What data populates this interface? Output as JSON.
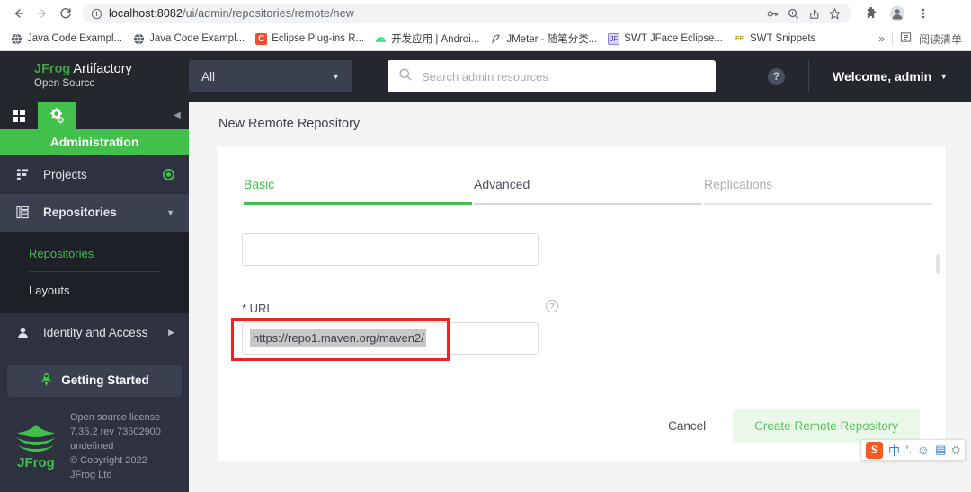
{
  "browser": {
    "nav": {
      "back_icon": "arrow-left-icon",
      "forward_icon": "arrow-right-icon",
      "reload_icon": "reload-icon"
    },
    "omnibox": {
      "site_info_icon": "info-circle-icon",
      "host": "localhost:8082",
      "path": "/ui/admin/repositories/remote/new",
      "actions": [
        "key-icon",
        "zoom-icon",
        "share-icon",
        "star-icon"
      ]
    },
    "toolbar_right": [
      "extensions-puzzle-icon",
      "profile-avatar-icon",
      "kebab-menu-icon"
    ],
    "bookmarks": [
      {
        "label": "Java Code Exampl...",
        "icon": "globe-icon"
      },
      {
        "label": "Java Code Exampl...",
        "icon": "globe-icon"
      },
      {
        "label": "Eclipse Plug-ins R...",
        "icon": "letter-c-icon"
      },
      {
        "label": "开发应用 | Androi...",
        "icon": "android-icon"
      },
      {
        "label": "JMeter - 随笔分类...",
        "icon": "feather-icon"
      },
      {
        "label": "SWT JFace Eclipse...",
        "icon": "blue-square-icon"
      },
      {
        "label": "SWT Snippets",
        "icon": "ef-icon"
      }
    ],
    "bookmarks_overflow": "»",
    "reading_list": {
      "label": "阅读清单",
      "icon": "reading-list-icon"
    }
  },
  "topbar": {
    "brand_jfrog": "JFrog",
    "brand_product": "Artifactory",
    "brand_edition": "Open Source",
    "scope_select": {
      "value": "All",
      "caret_icon": "chevron-down-icon"
    },
    "search": {
      "placeholder": "Search admin resources",
      "value": "",
      "icon": "search-icon"
    },
    "help_icon": "question-mark-icon",
    "user_menu": {
      "label": "Welcome, admin",
      "caret_icon": "chevron-down-icon"
    }
  },
  "sidebar": {
    "module_tabs": [
      {
        "name": "application",
        "icon": "grid-squares-icon",
        "active": false
      },
      {
        "name": "administration",
        "icon": "gears-icon",
        "active": true
      }
    ],
    "collapse_icon": "chevron-left-icon",
    "banner": "Administration",
    "nav": [
      {
        "label": "Projects",
        "icon": "projects-icon",
        "trailing": "radio-dot-icon"
      },
      {
        "label": "Repositories",
        "icon": "repositories-icon",
        "trailing": "chevron-down-icon"
      }
    ],
    "subnav": [
      {
        "label": "Repositories",
        "active": true
      },
      {
        "label": "Layouts",
        "active": false
      }
    ],
    "identity": {
      "label": "Identity and Access",
      "icon": "person-icon",
      "trailing": "chevron-right-icon"
    },
    "getting_started": {
      "label": "Getting Started",
      "icon": "rocket-icon"
    },
    "footer": {
      "logo_icon": "jfrog-logo-icon",
      "lines": [
        "Open source license",
        "7.35.2 rev 73502900",
        "undefined",
        "© Copyright 2022",
        "JFrog Ltd"
      ]
    }
  },
  "main": {
    "page_title": "New Remote Repository",
    "tabs": [
      {
        "label": "Basic",
        "state": "active"
      },
      {
        "label": "Advanced",
        "state": "inactive"
      },
      {
        "label": "Replications",
        "state": "muted"
      }
    ],
    "fields": {
      "first_field": {
        "value": "",
        "placeholder": ""
      },
      "url": {
        "label": "* URL",
        "value": "https://repo1.maven.org/maven2/",
        "help_icon": "question-mark-icon",
        "selected": true,
        "highlight_box": true
      }
    },
    "actions": {
      "cancel": "Cancel",
      "create": "Create Remote Repository"
    }
  },
  "ime": {
    "items": [
      {
        "name": "sogou-logo",
        "glyph": "S"
      },
      {
        "name": "chinese-mode",
        "glyph": "中"
      },
      {
        "name": "punctuation-mode",
        "glyph": "°,"
      },
      {
        "name": "emoji",
        "glyph": "☺"
      },
      {
        "name": "keyboard",
        "glyph": "▤"
      },
      {
        "name": "toolbox",
        "glyph": "⛭"
      }
    ]
  },
  "colors": {
    "accent_green": "#41c14b",
    "sidebar_bg": "#2e3240",
    "topbar_bg": "#25272f",
    "alert_red": "#ee2222"
  }
}
